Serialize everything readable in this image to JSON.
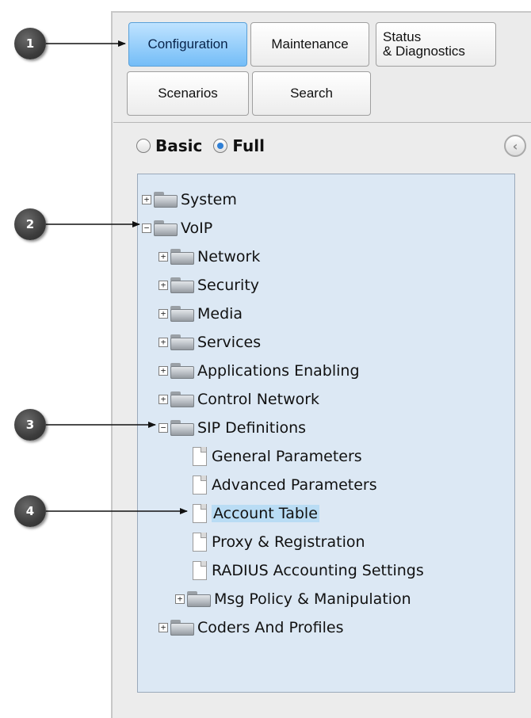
{
  "tabs": {
    "configuration": "Configuration",
    "maintenance": "Maintenance",
    "status_line1": "Status",
    "status_line2": "& Diagnostics",
    "scenarios": "Scenarios",
    "search": "Search"
  },
  "mode": {
    "basic": "Basic",
    "full": "Full",
    "selected": "Full"
  },
  "collapse_icon": "chevron-left-icon",
  "tree": {
    "system": "System",
    "voip": "VoIP",
    "network": "Network",
    "security": "Security",
    "media": "Media",
    "services": "Services",
    "applications": "Applications Enabling",
    "control_network": "Control Network",
    "sip_definitions": "SIP Definitions",
    "general_parameters": "General Parameters",
    "advanced_parameters": "Advanced Parameters",
    "account_table": "Account Table",
    "proxy_registration": "Proxy & Registration",
    "radius": "RADIUS Accounting Settings",
    "msg_policy": "Msg Policy & Manipulation",
    "coders": "Coders And Profiles",
    "selected": "Account Table"
  },
  "callouts": {
    "c1": "1",
    "c2": "2",
    "c3": "3",
    "c4": "4"
  }
}
